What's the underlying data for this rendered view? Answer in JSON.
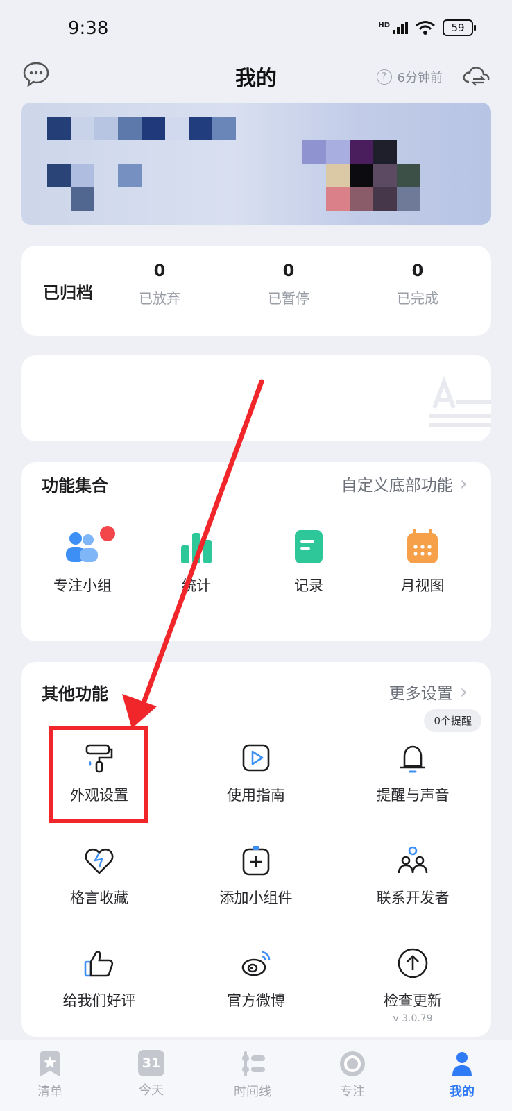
{
  "status_bar": {
    "time": "9:38",
    "network": "HD",
    "battery": "59"
  },
  "header": {
    "title": "我的",
    "sync_text": "6分钟前",
    "help_glyph": "?"
  },
  "archive": {
    "title": "已归档",
    "stats": [
      {
        "value": "0",
        "label": "已放弃"
      },
      {
        "value": "0",
        "label": "已暂停"
      },
      {
        "value": "0",
        "label": "已完成"
      }
    ]
  },
  "feature_collection": {
    "title": "功能集合",
    "link": "自定义底部功能",
    "items": [
      {
        "label": "专注小组",
        "icon": "group-icon",
        "has_badge": true
      },
      {
        "label": "统计",
        "icon": "chart-icon"
      },
      {
        "label": "记录",
        "icon": "note-icon"
      },
      {
        "label": "月视图",
        "icon": "calendar-icon"
      }
    ]
  },
  "other_features": {
    "title": "其他功能",
    "link": "更多设置",
    "reminder_bubble": "0个提醒",
    "version": "v 3.0.79",
    "items": [
      {
        "label": "外观设置",
        "icon": "paint-roller-icon"
      },
      {
        "label": "使用指南",
        "icon": "play-guide-icon"
      },
      {
        "label": "提醒与声音",
        "icon": "bell-icon"
      },
      {
        "label": "格言收藏",
        "icon": "heart-icon"
      },
      {
        "label": "添加小组件",
        "icon": "add-widget-icon"
      },
      {
        "label": "联系开发者",
        "icon": "people-icon"
      },
      {
        "label": "给我们好评",
        "icon": "thumbs-up-icon"
      },
      {
        "label": "官方微博",
        "icon": "weibo-icon"
      },
      {
        "label": "检查更新",
        "icon": "upload-arrow-icon"
      }
    ]
  },
  "bottom_nav": {
    "items": [
      {
        "label": "清单",
        "icon": "star-list-icon"
      },
      {
        "label": "今天",
        "icon": "calendar-day-icon",
        "glyph": "31"
      },
      {
        "label": "时间线",
        "icon": "timeline-icon"
      },
      {
        "label": "专注",
        "icon": "focus-icon"
      },
      {
        "label": "我的",
        "icon": "profile-icon",
        "active": true
      }
    ]
  },
  "colors": {
    "accent": "#2f7bf5",
    "annotation": "#f0262a",
    "background": "#eef0f5"
  }
}
